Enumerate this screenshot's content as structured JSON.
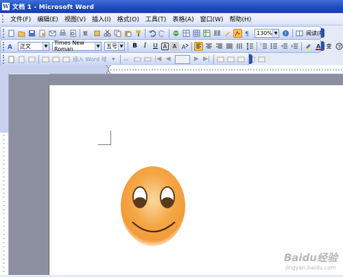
{
  "window": {
    "title": "文档 1 - Microsoft Word",
    "app_icon": "word-icon"
  },
  "menubar": {
    "items": [
      {
        "label": "文件(F)"
      },
      {
        "label": "编辑(E)"
      },
      {
        "label": "视图(V)"
      },
      {
        "label": "插入(I)"
      },
      {
        "label": "格式(O)"
      },
      {
        "label": "工具(T)"
      },
      {
        "label": "表格(A)"
      },
      {
        "label": "窗口(W)"
      },
      {
        "label": "帮助(H)"
      }
    ]
  },
  "standard_toolbar": {
    "zoom": "130%",
    "read_label": "阅读(R)"
  },
  "formatting_toolbar": {
    "style": "正文",
    "font": "Times New Roman",
    "size": "五号",
    "bold": "B",
    "italic": "I",
    "underline": "U",
    "char_border": "A",
    "char_scale": "A",
    "font_color": "A",
    "phonetic": "变"
  },
  "third_toolbar": {
    "insert_word_field": "插入 Word 域"
  },
  "colors": {
    "title_bar": "#1f4cc0",
    "toolbar_bg": "#c5d3f3",
    "active_button": "#f8c44a",
    "smiley_face": "#f29c3a",
    "document_bg": "#8c8fa0"
  },
  "document": {
    "content": "smiley-face-image"
  },
  "watermark": {
    "logo": "Baidu经验",
    "url": "jingyan.baidu.com"
  }
}
